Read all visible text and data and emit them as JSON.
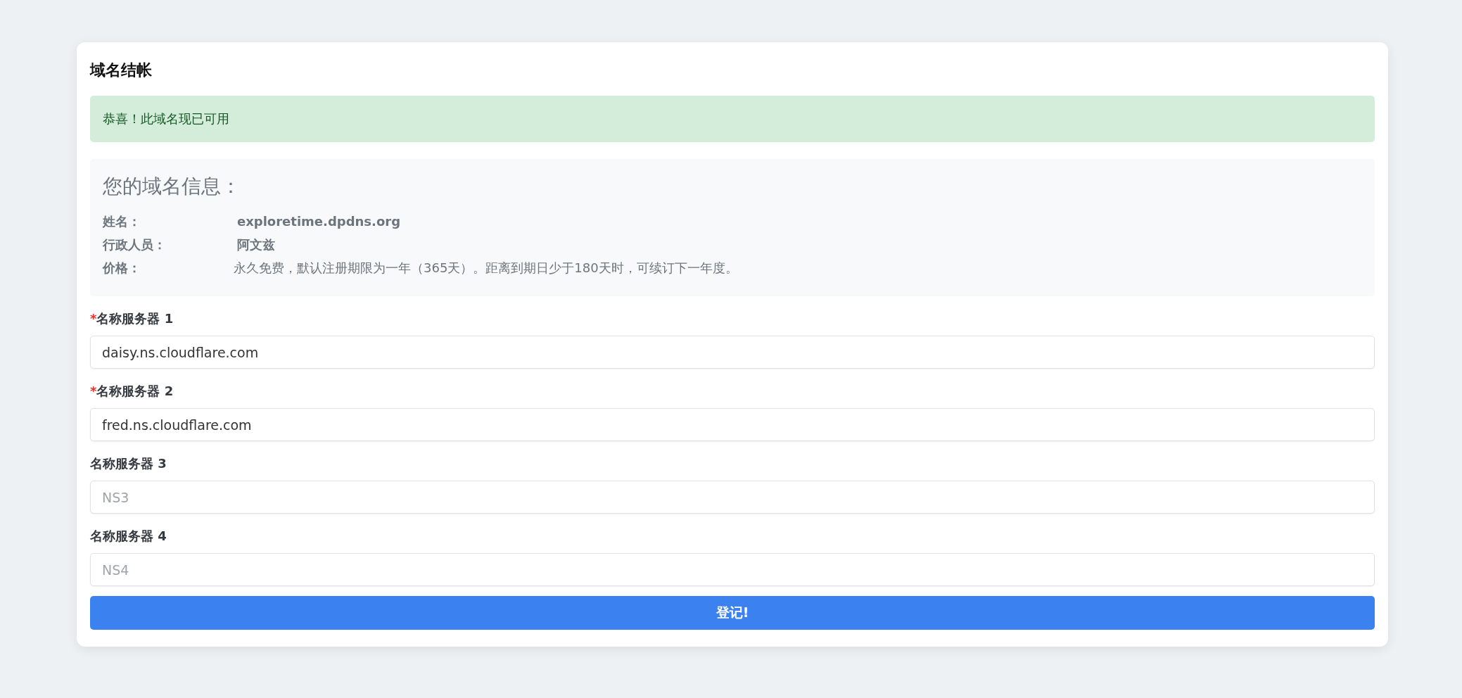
{
  "card": {
    "title": "域名结帐"
  },
  "alert": {
    "text": "恭喜！此域名现已可用"
  },
  "info": {
    "heading": "您的域名信息：",
    "rows": [
      {
        "label": "姓名：",
        "value": "exploretime.dpdns.org",
        "bold": true
      },
      {
        "label": "行政人员：",
        "value": "阿文兹",
        "bold": true
      },
      {
        "label": "价格：",
        "value": "永久免费，默认注册期限为一年（365天）。距离到期日少于180天时，可续订下一年度。",
        "bold": false
      }
    ]
  },
  "fields": [
    {
      "marker": "*",
      "label": "名称服务器 1",
      "value": "daisy.ns.cloudflare.com"
    },
    {
      "marker": "*",
      "label": "名称服务器 2",
      "value": "fred.ns.cloudflare.com"
    },
    {
      "label": "名称服务器 3",
      "placeholder": "NS3"
    },
    {
      "label": "名称服务器 4",
      "placeholder": "NS4"
    }
  ],
  "submit": {
    "label": "登记!"
  }
}
